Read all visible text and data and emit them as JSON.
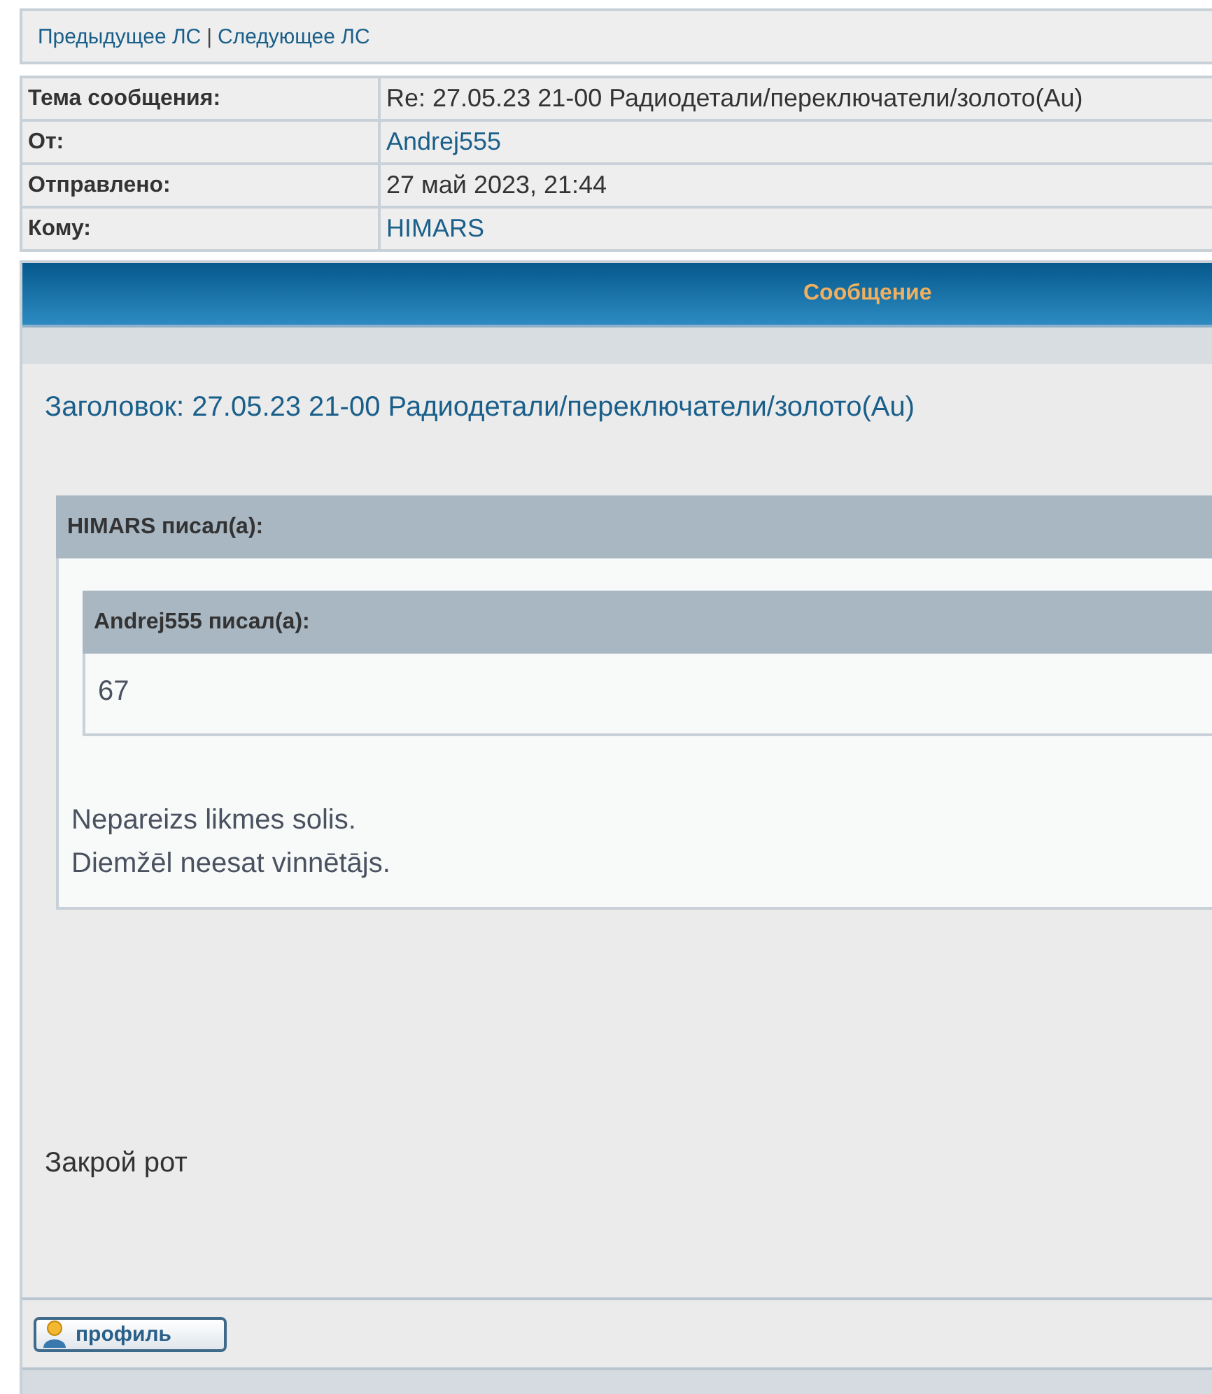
{
  "nav": {
    "links": [
      {
        "label": "Предыдущее ЛС"
      },
      {
        "label": "Следующее ЛС"
      }
    ],
    "separator": "|"
  },
  "headers": [
    {
      "label": "Тема сообщения:",
      "value": "Re: 27.05.23 21-00 Радиодетали/переключатели/золото(Au)",
      "kind": "text"
    },
    {
      "label": "От:",
      "value": "Andrej555",
      "kind": "link"
    },
    {
      "label": "Отправлено:",
      "value": "27 май 2023, 21:44",
      "kind": "text"
    },
    {
      "label": "Кому:",
      "value": "HIMARS",
      "kind": "link"
    }
  ],
  "message": {
    "heading": "Сообщение",
    "title": "Заголовок: 27.05.23 21-00 Радиодетали/переключатели/золото(Au)",
    "quote": {
      "author": "HIMARS писал(а):",
      "quote": {
        "author": "Andrej555 писал(а):",
        "lines": [
          "67"
        ]
      },
      "lines": [
        "Nepareizs likmes solis.",
        "Diemžēl neesat vinnētājs."
      ]
    },
    "text": "Закрой рот"
  },
  "buttons": [
    {
      "label": "профиль"
    }
  ]
}
